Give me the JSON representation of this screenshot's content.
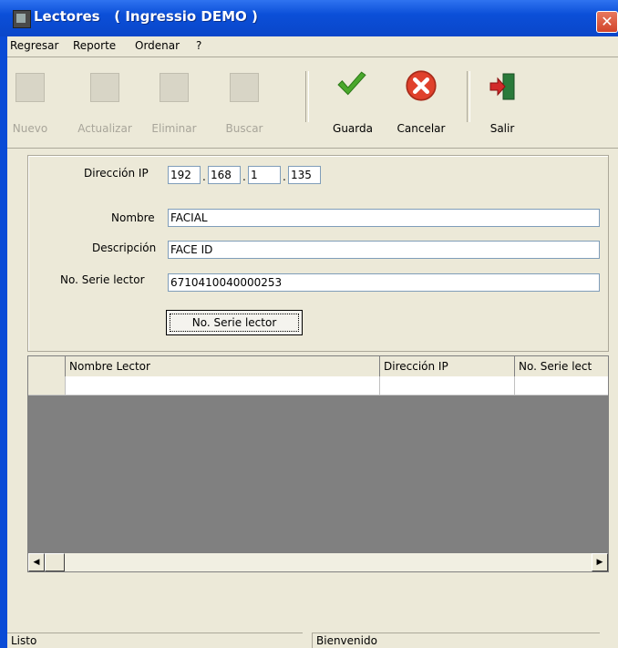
{
  "window": {
    "title": "Lectores   ( Ingressio DEMO )",
    "close_glyph": "✕"
  },
  "menu": [
    "Regresar",
    "Reporte",
    "Ordenar",
    "?"
  ],
  "toolbar": {
    "nuevo": "Nuevo",
    "actualizar": "Actualizar",
    "eliminar": "Eliminar",
    "buscar": "Buscar",
    "guarda": "Guarda",
    "cancelar": "Cancelar",
    "salir": "Salir"
  },
  "form": {
    "ip_label": "Dirección IP",
    "ip": [
      "192",
      "168",
      "1",
      "135"
    ],
    "ip_dot": ".",
    "nombre_label": "Nombre",
    "nombre": "FACIAL",
    "descripcion_label": "Descripción",
    "descripcion": "FACE ID",
    "serie_label": "No. Serie lector",
    "serie": "6710410040000253",
    "serie_button": "No. Serie lector"
  },
  "grid": {
    "columns": [
      "Nombre Lector",
      "Dirección IP",
      "No. Serie lect"
    ],
    "scroll_left": "◀",
    "scroll_right": "▶"
  },
  "status": {
    "left": "Listo",
    "right": "Bienvenido"
  },
  "colors": {
    "title_bar": "#0b4fd8",
    "face": "#ece9d8",
    "guarda_icon": "#4aa82c",
    "cancel_icon": "#e0412c",
    "exit_icon": "#d22a2a"
  }
}
